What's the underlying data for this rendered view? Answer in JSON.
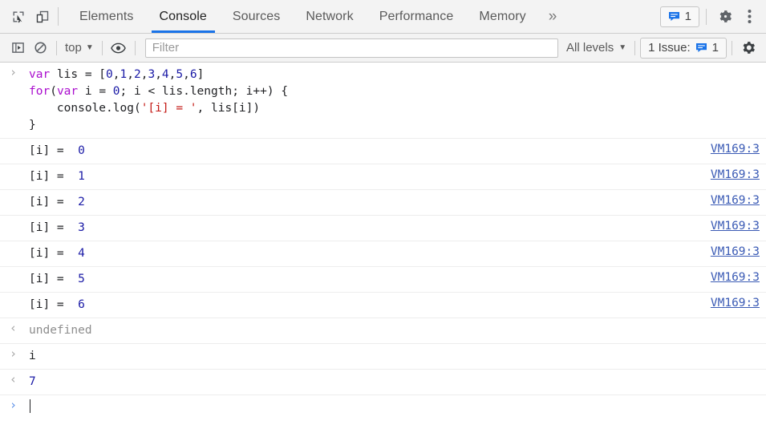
{
  "window": {
    "title": "Chrome DevTools - Console"
  },
  "tabbar": {
    "icons": [
      {
        "name": "inspect-element-icon",
        "label": "Inspect element"
      },
      {
        "name": "device-toolbar-icon",
        "label": "Toggle device toolbar"
      }
    ],
    "tabs": [
      {
        "label": "Elements",
        "active": false
      },
      {
        "label": "Console",
        "active": true
      },
      {
        "label": "Sources",
        "active": false
      },
      {
        "label": "Network",
        "active": false
      },
      {
        "label": "Performance",
        "active": false
      },
      {
        "label": "Memory",
        "active": false
      }
    ],
    "more_label": "»",
    "messages_badge": {
      "icon": "message-bubble-icon",
      "count": "1"
    },
    "settings_label": "Settings",
    "menu_label": "Customize and control DevTools"
  },
  "console_toolbar": {
    "sidebar_toggle": "console-sidebar-icon",
    "clear_console": "clear-console-icon",
    "context": {
      "label": "top",
      "caret": "▼"
    },
    "eye_icon": "live-expression-icon",
    "filter": {
      "value": "",
      "placeholder": "Filter"
    },
    "levels": {
      "label": "All levels",
      "caret": "▼"
    },
    "issues": {
      "label": "1 Issue:",
      "icon": "message-bubble-icon",
      "count": "1"
    },
    "settings_icon": "gear-icon"
  },
  "console": {
    "input_block": {
      "prompt": "›",
      "lines": [
        [
          {
            "t": "kw",
            "v": "var"
          },
          {
            "t": "plain",
            "v": " lis = ["
          },
          {
            "t": "num",
            "v": "0"
          },
          {
            "t": "plain",
            "v": ","
          },
          {
            "t": "num",
            "v": "1"
          },
          {
            "t": "plain",
            "v": ","
          },
          {
            "t": "num",
            "v": "2"
          },
          {
            "t": "plain",
            "v": ","
          },
          {
            "t": "num",
            "v": "3"
          },
          {
            "t": "plain",
            "v": ","
          },
          {
            "t": "num",
            "v": "4"
          },
          {
            "t": "plain",
            "v": ","
          },
          {
            "t": "num",
            "v": "5"
          },
          {
            "t": "plain",
            "v": ","
          },
          {
            "t": "num",
            "v": "6"
          },
          {
            "t": "plain",
            "v": "]"
          }
        ],
        [
          {
            "t": "kw",
            "v": "for"
          },
          {
            "t": "plain",
            "v": "("
          },
          {
            "t": "kw",
            "v": "var"
          },
          {
            "t": "plain",
            "v": " i = "
          },
          {
            "t": "num",
            "v": "0"
          },
          {
            "t": "plain",
            "v": "; i < lis.length; i++) {"
          }
        ],
        [
          {
            "t": "plain",
            "v": "    console.log("
          },
          {
            "t": "str",
            "v": "'[i] = '"
          },
          {
            "t": "plain",
            "v": ", lis[i])"
          }
        ],
        [
          {
            "t": "plain",
            "v": "}"
          }
        ]
      ]
    },
    "log_rows": [
      {
        "prefix": "[i] =  ",
        "value": "0",
        "source": "VM169:3"
      },
      {
        "prefix": "[i] =  ",
        "value": "1",
        "source": "VM169:3"
      },
      {
        "prefix": "[i] =  ",
        "value": "2",
        "source": "VM169:3"
      },
      {
        "prefix": "[i] =  ",
        "value": "3",
        "source": "VM169:3"
      },
      {
        "prefix": "[i] =  ",
        "value": "4",
        "source": "VM169:3"
      },
      {
        "prefix": "[i] =  ",
        "value": "5",
        "source": "VM169:3"
      },
      {
        "prefix": "[i] =  ",
        "value": "6",
        "source": "VM169:3"
      }
    ],
    "result_undefined": {
      "arrow": "‹",
      "text": "undefined"
    },
    "eval_i": {
      "prompt": "›",
      "text": "i"
    },
    "result_i": {
      "arrow": "‹",
      "text": "7"
    },
    "active_prompt": {
      "prompt": "›",
      "value": ""
    }
  },
  "colors": {
    "accent": "#1a73e8",
    "toolbar_bg": "#f3f3f3",
    "border": "#cdcdcd",
    "keyword": "#aa0dce",
    "number": "#1a1aa6",
    "string": "#c41a16",
    "link": "#3b5bb5",
    "muted_text": "#8d8d8d"
  }
}
